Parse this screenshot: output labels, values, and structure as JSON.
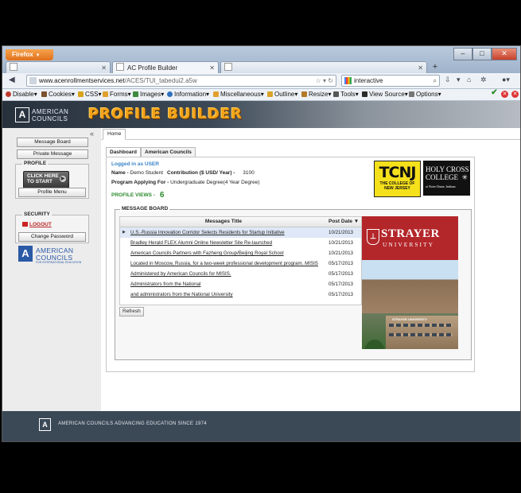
{
  "browser": {
    "menu_label": "Firefox",
    "tabs": [
      {
        "label": ""
      },
      {
        "label": "AC Profile Builder"
      },
      {
        "label": ""
      }
    ],
    "new_tab": "+",
    "url_domain": "www.acenrollmentservices.net",
    "url_path": "/ACES/TUI_tabedui2.a5w",
    "search_value": "interactive",
    "window_controls": {
      "minimize": "–",
      "maximize": "□",
      "close": "✕"
    }
  },
  "devbar": {
    "items": [
      {
        "label": "Disable",
        "icon": "disable-icon",
        "color": "#c0392b"
      },
      {
        "label": "Cookies",
        "icon": "cookie-icon",
        "color": "#7a5230"
      },
      {
        "label": "CSS",
        "icon": "css-icon",
        "color": "#d8a21c"
      },
      {
        "label": "Forms",
        "icon": "forms-icon",
        "color": "#e0a030"
      },
      {
        "label": "Images",
        "icon": "images-icon",
        "color": "#3d8a3d"
      },
      {
        "label": "Information",
        "icon": "information-icon",
        "color": "#2f6fbf"
      },
      {
        "label": "Miscellaneous",
        "icon": "misc-icon",
        "color": "#e0a030"
      },
      {
        "label": "Outline",
        "icon": "outline-icon",
        "color": "#d9a32a"
      },
      {
        "label": "Resize",
        "icon": "resize-icon",
        "color": "#b07a2a"
      },
      {
        "label": "Tools",
        "icon": "tools-icon",
        "color": "#555555"
      },
      {
        "label": "View Source",
        "icon": "view-source-icon",
        "color": "#2a2a2a"
      },
      {
        "label": "Options",
        "icon": "options-icon",
        "color": "#777777"
      }
    ]
  },
  "header": {
    "org_line1": "AMERICAN",
    "org_line2": "COUNCILS",
    "app_title": "PROFILE BUILDER"
  },
  "sidebar": {
    "collapse": "«",
    "message_board": "Message Board",
    "private_message": "Private Message",
    "profile_heading": "PROFILE",
    "click_here_line1": "CLICK HERE",
    "click_here_line2": "TO START",
    "profile_menu": "Profile Menu",
    "security_heading": "SECURITY",
    "logout": "LOGOUT",
    "change_password": "Change Password",
    "ac_line1": "AMERICAN",
    "ac_line2": "COUNCILS",
    "ac_tagline": "FOR INTERNATIONAL EDUCATION"
  },
  "content": {
    "home_tab": "Home",
    "subtabs": [
      "Dashboard",
      "American Councils"
    ],
    "logged_in": "Logged in as USER",
    "name_label": "Name -",
    "name_value": "Demo Student",
    "contribution_label": "Contribution ($ USD/ Year) -",
    "contribution_value": "3100",
    "program_label": "Program Applying For -",
    "program_value": "Undergraduate Degree(4 Year Degree)",
    "views_label": "PROFILE VIEWS -",
    "views_value": "6"
  },
  "ads": {
    "tcnj_big": "TCNJ",
    "tcnj_small1": "THE COLLEGE OF",
    "tcnj_small2": "NEW JERSEY",
    "hc_line1": "HOLY CROSS",
    "hc_line2": "COLLEGE",
    "hc_line3": "at Notre Dame, Indiana",
    "strayer_name": "STRAYER",
    "strayer_sub": "UNIVERSITY",
    "strayer_sign": "STRAYER UNIVERSITY"
  },
  "message_board": {
    "heading": "MESSAGE BOARD",
    "col_title": "Messages Title",
    "col_date": "Post Date",
    "refresh": "Refresh",
    "rows": [
      {
        "title": "U.S.-Russia Innovation Corridor Selects Residents for Startup Initiative",
        "date": "10/21/2013"
      },
      {
        "title": "Bradley Herald FLEX Alumni Online Newsletter Site Re-launched",
        "date": "10/21/2013"
      },
      {
        "title": "American Councils Partners with Fazheng Group/Beijing Royal School",
        "date": "10/21/2013"
      },
      {
        "title": "Located in Moscow, Russia, for a two-week professional development program. MISIS",
        "date": "05/17/2013"
      },
      {
        "title": "Administered by American Councils for MISIS.",
        "date": "05/17/2013"
      },
      {
        "title": "Administrators from the National",
        "date": "05/17/2013"
      },
      {
        "title": "and administrators from the National University",
        "date": "05/17/2013"
      }
    ]
  },
  "footer": {
    "text": "AMERICAN COUNCILS ADVANCING EDUCATION SINCE 1974"
  }
}
